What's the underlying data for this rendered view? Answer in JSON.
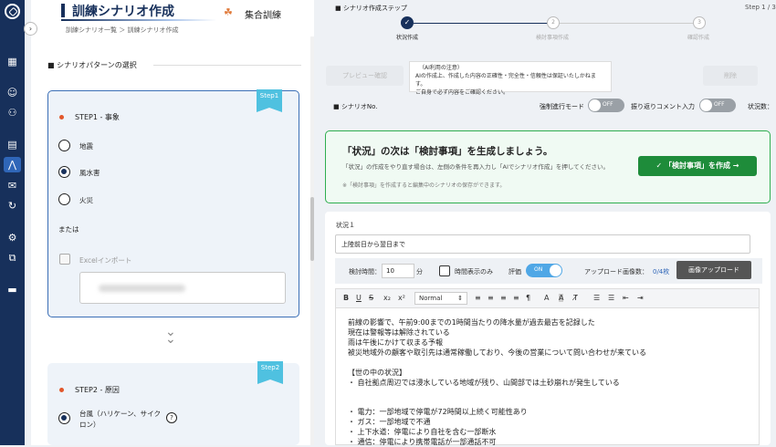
{
  "sidebar": {
    "icons": [
      "logo-icon",
      "grid-icon",
      "user-icon",
      "group-icon",
      "document-icon",
      "scenario-icon",
      "mail-icon",
      "cycle-icon",
      "user-settings-icon",
      "org-icon",
      "folder-icon"
    ],
    "collapse_glyph": "›"
  },
  "header": {
    "title": "訓練シナリオ作成",
    "mode_label": "集合訓練",
    "breadcrumb": "訓練シナリオ一覧 ＞ 訓練シナリオ作成"
  },
  "left": {
    "section_title": "■ シナリオパターンの選択",
    "step1": {
      "ribbon": "Step1",
      "title": "STEP1 - 事象",
      "options": [
        {
          "label": "地震",
          "selected": false
        },
        {
          "label": "風水害",
          "selected": true
        },
        {
          "label": "火災",
          "selected": false
        }
      ],
      "or_label": "または",
      "excel_label": "Excelインポート"
    },
    "step2": {
      "ribbon": "Step2",
      "title": "STEP2 - 原因",
      "options": [
        {
          "label": "台風（ハリケーン、サイクロン）",
          "selected": true
        }
      ],
      "help_icon": "help-icon"
    }
  },
  "wizard": {
    "label": "■ シナリオ作成ステップ",
    "count": "Step 1 / 3",
    "steps": [
      {
        "label": "状況作成",
        "number": "1",
        "state": "done"
      },
      {
        "label": "検討事項作成",
        "number": "2",
        "state": "todo"
      },
      {
        "label": "確認作成",
        "number": "3",
        "state": "todo"
      }
    ]
  },
  "toolbar_top": {
    "preview_label": "プレビュー",
    "preview_sub": "確認",
    "notice_lines": [
      "（AI利用の注意）",
      "AIの作成上、作成した内容の正確性・完全性・信頼性は保証いたしかねます。",
      "ご自身で必ず内容をご確認ください。"
    ],
    "delete_label": "削除"
  },
  "settings": {
    "scenario_no_label": "■ シナリオNo.",
    "force_mode_label": "強制進行モード",
    "force_mode_state": "OFF",
    "comment_label": "振り返りコメント入力",
    "comment_state": "OFF",
    "status_label": "状況数："
  },
  "banner": {
    "title": "「状況」の次は「検討事項」を生成しましょう。",
    "desc": "「状況」の作成をやり直す場合は、左側の条件を再入力し「AIでシナリオ作成」を押してください。",
    "note": "※「検討事項」を作成すると編集中のシナリオの保存ができます。",
    "button_label": "「検討事項」を作成 →",
    "check_glyph": "✓"
  },
  "editor": {
    "situation_label": "状況１",
    "situation_value": "上陸前日から翌日まで",
    "time_label": "検討時間：",
    "time_value": "10",
    "time_unit": "分",
    "show_time_label": "時間表示のみ",
    "eval_label": "評価",
    "eval_state": "ON",
    "upload_count_label": "アップロード画像数：",
    "upload_count": "0/4枚",
    "upload_button": "画像アップロード",
    "font_select": "Normal",
    "body_lines": [
      "前線の影響で、午前9:00までの1時間当たりの降水量が過去最古を記録した",
      "現在は警報等は解除されている",
      "雨は午後にかけて収まる予報",
      "被災地域外の顧客や取引先は通常稼働しており、今後の営業について問い合わせが来ている",
      "",
      "【世の中の状況】",
      "・ 自社拠点周辺では浸水している地域が残り、山間部では土砂崩れが発生している",
      "",
      "",
      "・ 電力：一部地域で停電が72時間以上続く可能性あり",
      "・ ガス：一部地域で不通",
      "・ 上下水道：停電により自社を含む一部断水",
      "・ 通信：停電により携帯電話が一部通話不可"
    ]
  }
}
